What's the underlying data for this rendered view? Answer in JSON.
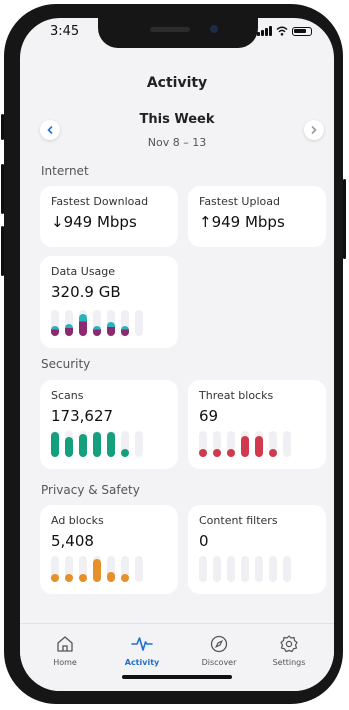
{
  "status": {
    "time": "3:45"
  },
  "page": {
    "title": "Activity",
    "week_title": "This Week",
    "week_range": "Nov 8 – 13",
    "prev_icon": "chevron-left-icon",
    "next_icon": "chevron-right-icon"
  },
  "internet": {
    "heading": "Internet",
    "fastest_download": {
      "label": "Fastest Download",
      "value": "↓949 Mbps"
    },
    "fastest_upload": {
      "label": "Fastest Upload",
      "value": "↑949 Mbps"
    },
    "data_usage": {
      "label": "Data Usage",
      "value": "320.9 GB",
      "bars": [
        0.4,
        0.45,
        0.85,
        0.4,
        0.55,
        0.4,
        0
      ],
      "color_top": "#2ab3b8",
      "color_bottom": "#8b2a6e"
    }
  },
  "security": {
    "heading": "Security",
    "scans": {
      "label": "Scans",
      "value": "173,627",
      "bars": [
        0.95,
        0.75,
        0.9,
        0.95,
        0.95,
        0.3,
        0
      ],
      "color": "#14a07c"
    },
    "threat_blocks": {
      "label": "Threat blocks",
      "value": "69",
      "bars": [
        0.25,
        0.25,
        0.25,
        0.8,
        0.8,
        0.25,
        0
      ],
      "color": "#d13a4d"
    }
  },
  "privacy": {
    "heading": "Privacy & Safety",
    "ad_blocks": {
      "label": "Ad blocks",
      "value": "5,408",
      "bars": [
        0.25,
        0.25,
        0.3,
        0.9,
        0.4,
        0.25,
        0
      ],
      "color": "#e6902a"
    },
    "content_filters": {
      "label": "Content filters",
      "value": "0",
      "bars": [
        0,
        0,
        0,
        0,
        0,
        0,
        0
      ],
      "color": "#cccccc"
    }
  },
  "tabs": [
    {
      "label": "Home",
      "icon": "home-icon",
      "active": false
    },
    {
      "label": "Activity",
      "icon": "activity-pulse-icon",
      "active": true
    },
    {
      "label": "Discover",
      "icon": "compass-icon",
      "active": false
    },
    {
      "label": "Settings",
      "icon": "gear-icon",
      "active": false
    }
  ],
  "colors": {
    "accent": "#1f6fd6",
    "background": "#f3f2f5",
    "card": "#ffffff"
  }
}
